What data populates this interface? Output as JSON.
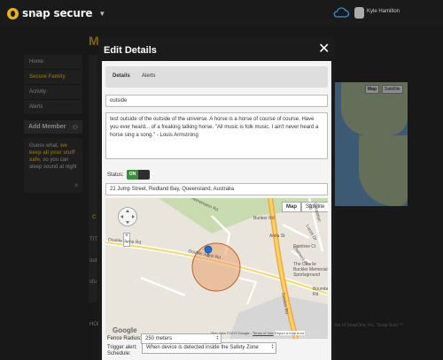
{
  "app": {
    "logo_text": "snap secure",
    "user_name": "Kyle Hamilton",
    "page_title_fragment": "My"
  },
  "sidebar": {
    "items": [
      {
        "label": "Home"
      },
      {
        "label": "Secure Family"
      },
      {
        "label": "Activity"
      },
      {
        "label": "Alerts"
      }
    ],
    "add_member_label": "Add Member",
    "promo": {
      "part1": "Guess what, ",
      "highlight": "we keep all your stuff safe",
      "part2": ", so you can sleep sound at night"
    }
  },
  "background_fragments": {
    "frag1": "TIT",
    "frag2": "out",
    "frag3": "sfu",
    "frag4": "HOI",
    "frag5": "C",
    "footer": "arks of SnapOne, Inc. 'Snap Sure'™"
  },
  "background_map": {
    "map_label": "Map",
    "satellite_label": "Satellite"
  },
  "modal": {
    "title": "Edit Details",
    "tabs": [
      {
        "label": "Details"
      },
      {
        "label": "Alerts"
      }
    ],
    "name_value": "outside",
    "description_value": "test outside of the outside of the universe. A horse is a horse of course of course. Have you ever heard... of a freaking talking horse. \"All music is folk music. I ain't never heard a horse sing a song.\" - Louis Armstrong",
    "status_label": "Status:",
    "status_value": "ON",
    "address_value": "21 Jump Street, Redland Bay, Queensland, Australia",
    "map": {
      "map_label": "Map",
      "satellite_label": "Satellite",
      "roads": [
        "Double Jump Rd",
        "Double Jump Rd",
        "Heinemann Rd",
        "Anita St",
        "Lucas Dr",
        "Cherwell Ct",
        "Daintree Ct",
        "Bunker Rd",
        "Sebastian Rd",
        "Boundary Rd",
        "Gordon Rd",
        "The Charlie Buckler Memorial Sportsground"
      ],
      "google_label": "Google",
      "data_label": "Map data ©2013 Google",
      "terms_label": "Terms of Use",
      "report_label": "Report a map error"
    },
    "trigger_label": "Trigger alert:",
    "trigger_value": "When device is detected inside the Safety Zone",
    "radius_label": "Fence Radius:",
    "radius_value": "250 meters",
    "schedule_label": "Schedule:"
  },
  "colors": {
    "accent": "#e7b418",
    "toggle_on": "#3b8f3b",
    "zone_fill": "#e8a06e",
    "zone_stroke": "#c0622a",
    "marker": "#1f6fd1"
  }
}
